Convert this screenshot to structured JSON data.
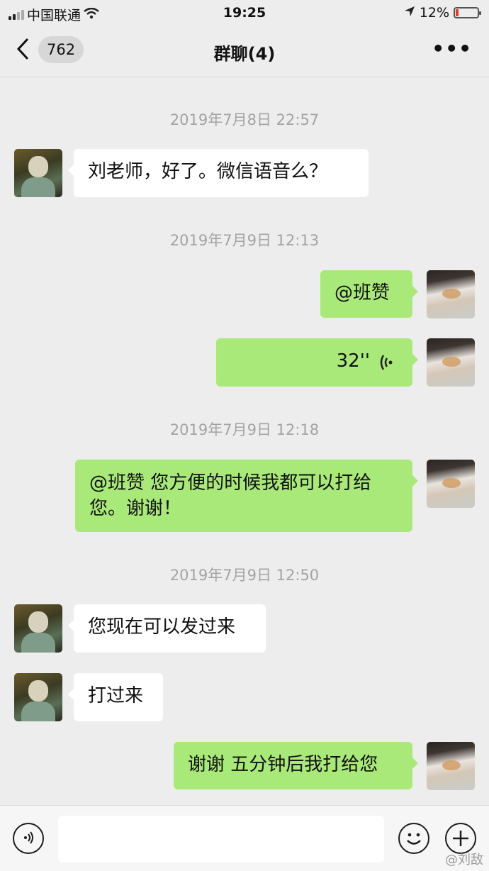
{
  "status": {
    "carrier": "中国联通",
    "time": "19:25",
    "battery": "12%",
    "battery_level": 0.12
  },
  "nav": {
    "unread": "762",
    "title": "群聊(4)"
  },
  "messages": {
    "ts1": "2019年7月8日 22:57",
    "m1": "刘老师，好了。微信语音么？",
    "ts2": "2019年7月9日 12:13",
    "m2": "@班赞",
    "m3": "32''",
    "ts3": "2019年7月9日 12:18",
    "m4": "@班赞 您方便的时候我都可以打给您。谢谢！",
    "ts4": "2019年7月9日 12:50",
    "m5": "您现在可以发过来",
    "m6": "打过来",
    "m7": "谢谢 五分钟后我打给您"
  },
  "watermark": "@刘敌",
  "colors": {
    "out_bubble": "#a9e97a",
    "in_bubble": "#ffffff",
    "background": "#ededed"
  }
}
